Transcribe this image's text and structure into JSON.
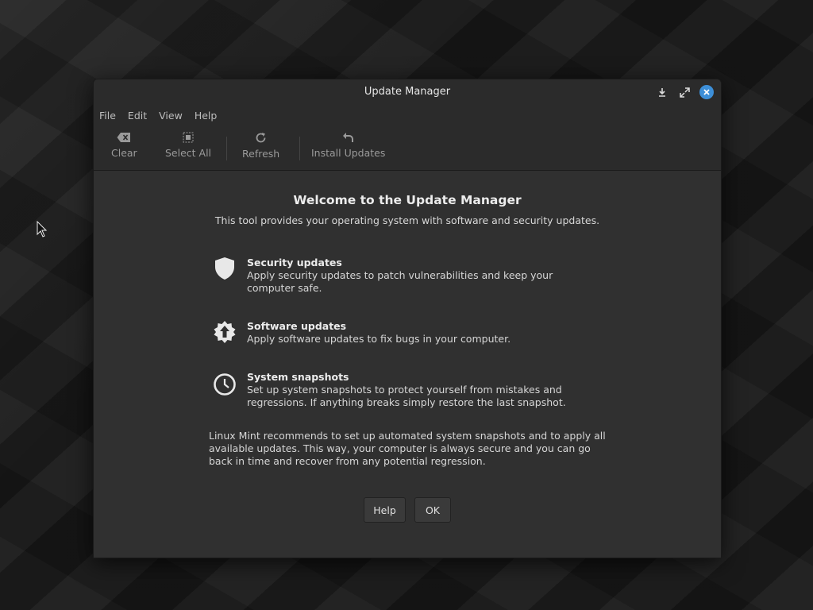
{
  "window": {
    "title": "Update Manager"
  },
  "menubar": {
    "items": [
      "File",
      "Edit",
      "View",
      "Help"
    ]
  },
  "toolbar": {
    "clear": {
      "label": "Clear",
      "icon": "backspace-icon"
    },
    "select_all": {
      "label": "Select All",
      "icon": "select-all-icon"
    },
    "refresh": {
      "label": "Refresh",
      "icon": "refresh-icon"
    },
    "install_updates": {
      "label": "Install Updates",
      "icon": "undo-arrow-icon"
    }
  },
  "welcome": {
    "title": "Welcome to the Update Manager",
    "subtitle": "This tool provides your operating system with software and security updates."
  },
  "features": [
    {
      "icon": "shield-icon",
      "title": "Security updates",
      "description": "Apply security updates to patch vulnerabilities and keep your computer safe."
    },
    {
      "icon": "upgrade-arrow-icon",
      "title": "Software updates",
      "description": "Apply software updates to fix bugs in your computer."
    },
    {
      "icon": "clock-icon",
      "title": "System snapshots",
      "description": "Set up system snapshots to protect yourself from mistakes and regressions. If anything breaks simply restore the last snapshot."
    }
  ],
  "note": "Linux Mint recommends to set up automated system snapshots and to apply all available updates. This way, your computer is always secure and you can go back in time and recover from any potential regression.",
  "buttons": {
    "help": "Help",
    "ok": "OK"
  },
  "colors": {
    "close_button": "#3d8fd8",
    "window_bg": "#303030",
    "header_bg": "#2b2b2b"
  }
}
